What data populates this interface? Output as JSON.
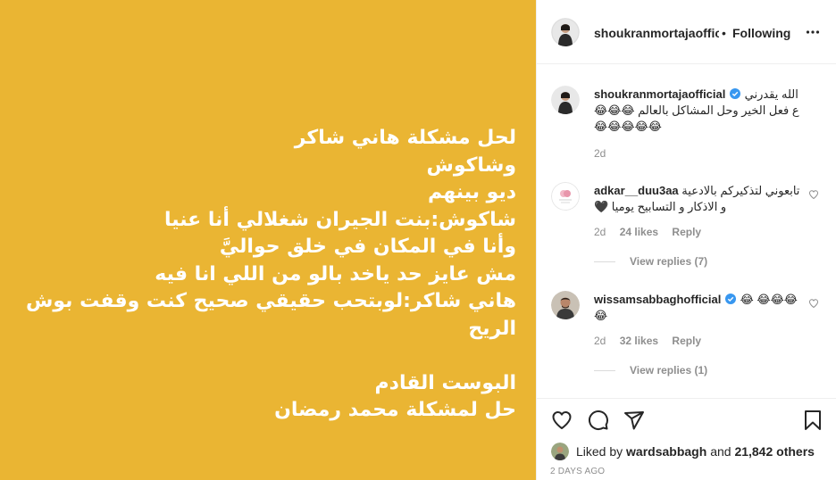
{
  "post": {
    "background_color": "#eab533",
    "text": "لحل مشكلة هاني شاكر\nوشاكوش\nديو بينهم\nشاكوش:بنت الجيران شغلالي أنا عنيا\nوأنا في المكان في خلق حواليَّ\nمش عايز حد ياخد بالو من اللي انا فيه\nهاني شاكر:لوبتحب حقيقي صحيح كنت وقفت بوش\nالريح\n\nالبوست القادم\nحل لمشكلة محمد رمضان"
  },
  "header": {
    "username": "shoukranmortajaofficial",
    "separator": "•",
    "follow_status": "Following",
    "more_icon": "more-horizontal-icon"
  },
  "caption": {
    "username": "shoukranmortajaofficial",
    "verified": true,
    "text": "الله يقدرني ع فعل الخير وحل المشاكل بالعالم 😂😂😂 😂😂😂😂😂",
    "time": "2d"
  },
  "comments": [
    {
      "username": "adkar__duu3aa",
      "text": "تابعوني لتذكيركم بالادعية و الاذكار و التسابيح يوميا 🖤",
      "time": "2d",
      "likes": "24 likes",
      "reply": "Reply",
      "view_replies": "View replies (7)"
    },
    {
      "username": "wissamsabbaghofficial",
      "verified": true,
      "text": "😂😂😂 😂😂",
      "time": "2d",
      "likes": "32 likes",
      "reply": "Reply",
      "view_replies": "View replies (1)"
    }
  ],
  "actions": {
    "like_icon": "heart-icon",
    "comment_icon": "comment-icon",
    "share_icon": "share-icon",
    "save_icon": "bookmark-icon"
  },
  "likes": {
    "prefix": "Liked by",
    "user": "wardsabbagh",
    "conjunction": "and",
    "count": "21,842 others"
  },
  "timestamp": "2 DAYS AGO",
  "colors": {
    "accent": "#0095f6",
    "verified": "#3897f0",
    "muted": "#8e8e8e"
  }
}
